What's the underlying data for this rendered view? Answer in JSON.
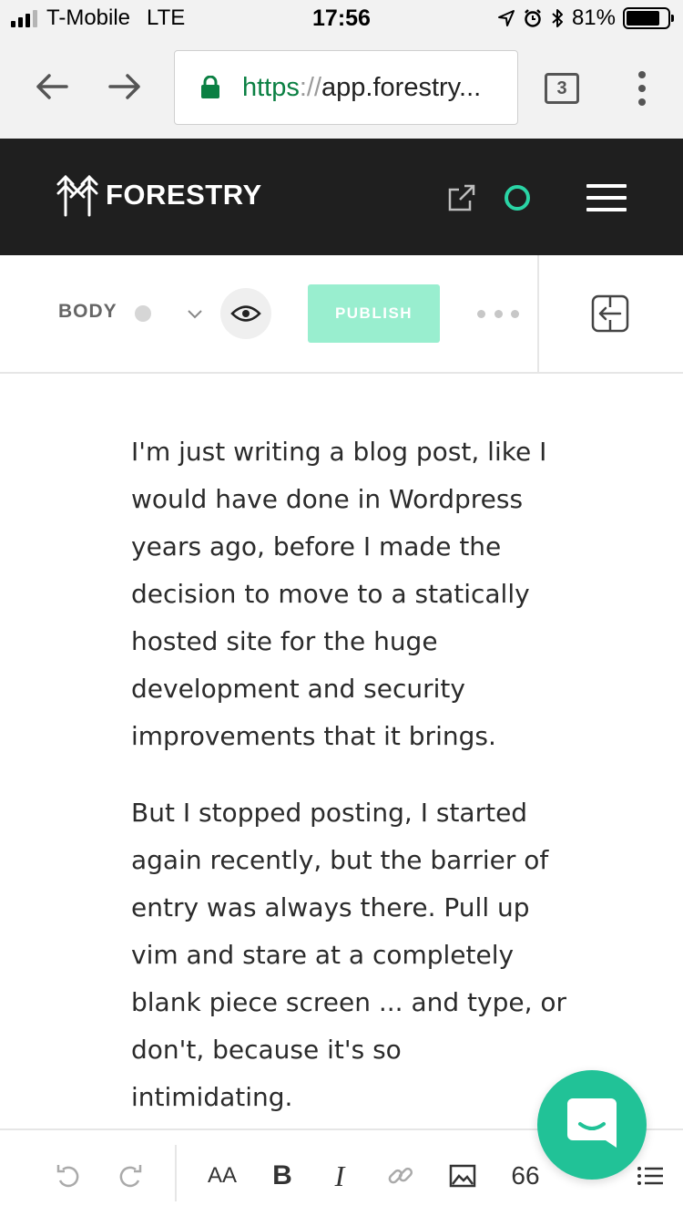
{
  "status_bar": {
    "carrier": "T-Mobile",
    "network": "LTE",
    "time": "17:56",
    "battery_percent": "81%",
    "battery_level": 0.81
  },
  "browser": {
    "url_scheme": "https",
    "url_separator": "://",
    "url_host": "app.forestry...",
    "tab_count": "3",
    "icons": [
      "back-arrow-icon",
      "forward-arrow-icon",
      "lock-icon",
      "tabs-icon",
      "overflow-menu-icon"
    ]
  },
  "app_header": {
    "logo_text": "FORESTRY",
    "icons": [
      "forestry-logo-icon",
      "external-link-icon",
      "status-ring-icon",
      "hamburger-icon"
    ],
    "accent_color": "#2ad4a5",
    "background": "#1f1f1f"
  },
  "editor_toolbar": {
    "section_label": "BODY",
    "publish_label": "PUBLISH",
    "publish_color": "#99eecf",
    "icons": [
      "status-dot-icon",
      "chevron-down-icon",
      "eye-icon",
      "more-dots-icon",
      "sidebar-toggle-icon"
    ]
  },
  "content": {
    "paragraphs": [
      "I'm just writing a blog post, like I would have done in Wordpress years ago, before I made the decision to move to a statically hosted site for the huge development and security improvements that it brings.",
      "But I stopped posting, I started again recently, but the barrier of entry was always there. Pull up vim and stare at a completely blank piece screen ... and type, or don't, because it's so intimidating."
    ]
  },
  "format_toolbar": {
    "font_size_label": "AA",
    "bold_label": "B",
    "italic_label": "I",
    "quote_label": "66",
    "icons": [
      "undo-icon",
      "redo-icon",
      "font-size-icon",
      "bold-icon",
      "italic-icon",
      "link-icon",
      "image-icon",
      "quote-icon",
      "list-icon"
    ]
  },
  "chat": {
    "icon": "chat-bubble-icon",
    "color": "#21c297"
  }
}
